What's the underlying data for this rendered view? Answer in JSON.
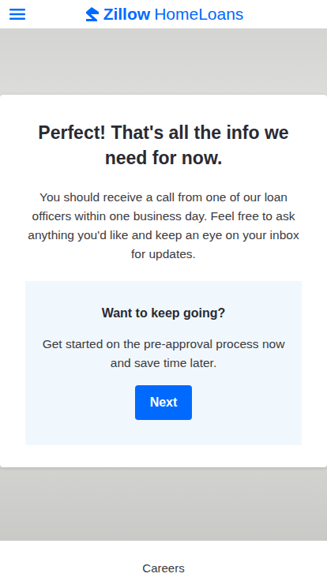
{
  "header": {
    "logo": {
      "brand": "Zillow",
      "product": "HomeLoans"
    }
  },
  "card": {
    "title": "Perfect! That's all the info we need for now.",
    "message": "You should receive a call from one of our loan officers within one business day. Feel free to ask anything you'd like and keep an eye on your inbox for updates.",
    "prompt": {
      "title": "Want to keep going?",
      "text": "Get started on the pre-approval process now and save time later.",
      "button": "Next"
    }
  },
  "footer": {
    "links": [
      "Careers"
    ]
  }
}
